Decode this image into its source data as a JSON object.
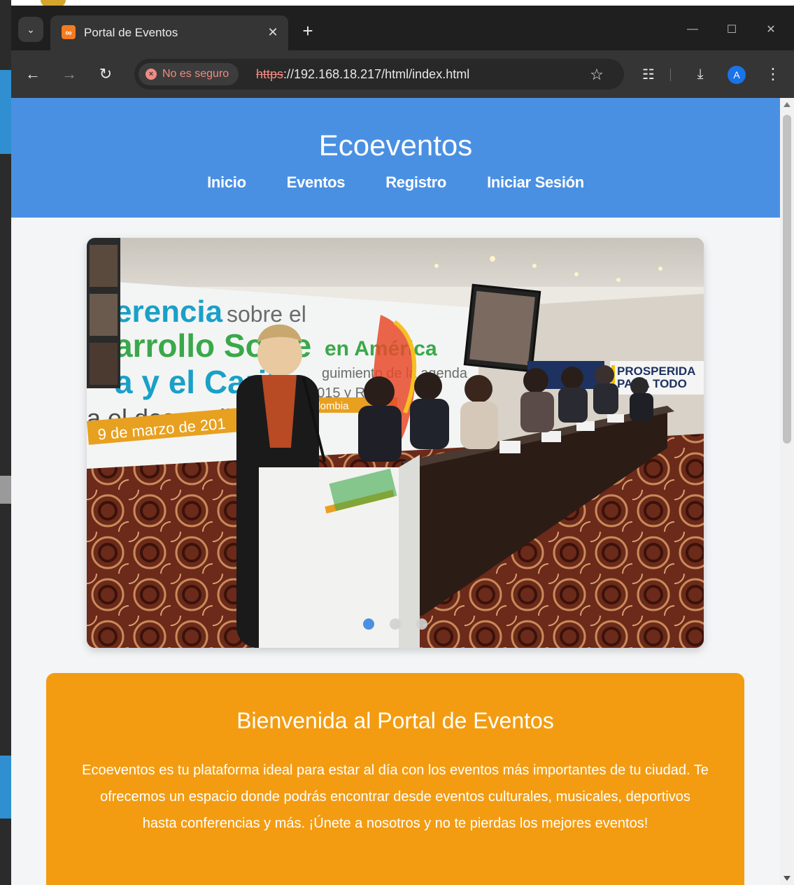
{
  "browser": {
    "tab_title": "Portal de Eventos",
    "security_label": "No es seguro",
    "url_scheme": "https",
    "url_rest": "://192.168.18.217/html/index.html",
    "avatar_initial": "A",
    "icons": [
      "tab-search-icon",
      "favicon-icon",
      "close-icon",
      "plus-icon",
      "minimize-icon",
      "maximize-icon",
      "back-arrow-icon",
      "forward-arrow-icon",
      "reload-icon",
      "warning-icon",
      "star-icon",
      "extensions-icon",
      "download-icon",
      "kebab-menu-icon"
    ]
  },
  "header": {
    "brand": "Ecoeventos",
    "nav": [
      "Inicio",
      "Eventos",
      "Registro",
      "Iniciar Sesión"
    ]
  },
  "carousel": {
    "slide_count": 3,
    "active_index": 0,
    "banner_text": {
      "line1a": "erencia",
      "line1b": "sobre el",
      "line2a": "arrollo Soste",
      "line2b": "en América",
      "line3": "a y el Carib",
      "line4": "a el desarrollo d",
      "line5": "9 de marzo de 201",
      "right_sign": "PROSPERIDA",
      "right_sign2": "PARA TODO",
      "agenda": "guimiento de la agenda",
      "rio": "2015 y Rio +",
      "country": "olombia"
    }
  },
  "welcome": {
    "title": "Bienvenida al Portal de Eventos",
    "body": "Ecoeventos es tu plataforma ideal para estar al día con los eventos más importantes de tu ciudad. Te ofrecemos un espacio donde podrás encontrar desde eventos culturales, musicales, deportivos hasta conferencias y más. ¡Únete a nosotros y no te pierdas los mejores eventos!"
  },
  "colors": {
    "header_blue": "#4a90e2",
    "card_orange": "#f39c12",
    "page_bg": "#f4f5f7"
  }
}
